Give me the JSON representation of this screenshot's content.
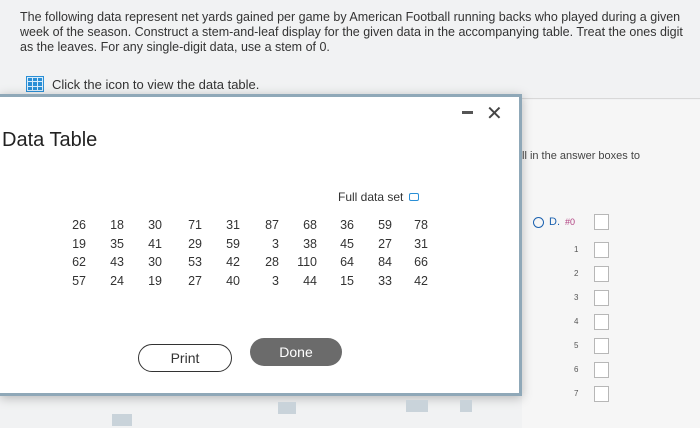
{
  "question": {
    "text": "The following data represent net yards gained per game by American Football running backs who played during a given week of the season. Construct a stem-and-leaf display for the given data in the accompanying table. Treat the ones digit as the leaves. For any single-digit data, use a stem of 0.",
    "view_link": "Click the icon to view the data table."
  },
  "dialog": {
    "title": "Data Table",
    "caption": "Full data set",
    "print_label": "Print",
    "done_label": "Done",
    "rows": [
      [
        "26",
        "18",
        "30",
        "71",
        "31",
        "87",
        "68",
        "36",
        "59",
        "78"
      ],
      [
        "19",
        "35",
        "41",
        "29",
        "59",
        "3",
        "38",
        "45",
        "27",
        "31"
      ],
      [
        "62",
        "43",
        "30",
        "53",
        "42",
        "28",
        "110",
        "64",
        "84",
        "66"
      ],
      [
        "57",
        "24",
        "19",
        "27",
        "40",
        "3",
        "44",
        "15",
        "33",
        "42"
      ]
    ]
  },
  "right_panel": {
    "instruction": "ll in the answer boxes to",
    "option_label": "D.",
    "option_head": "#0",
    "stems": [
      "1",
      "2",
      "3",
      "4",
      "5",
      "6",
      "7"
    ]
  }
}
